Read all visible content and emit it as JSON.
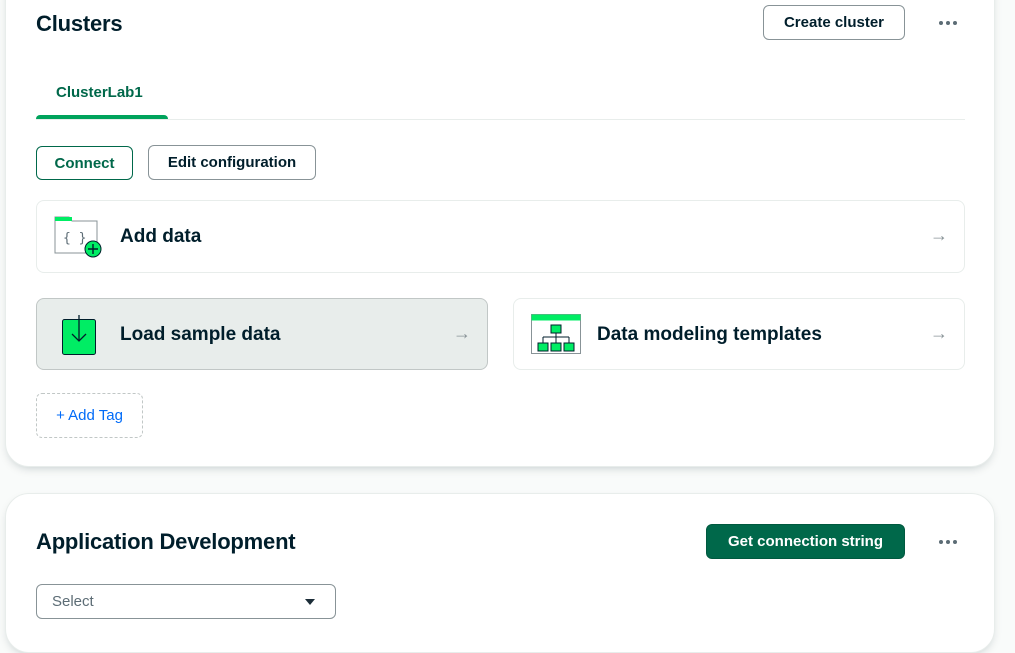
{
  "clusters": {
    "title": "Clusters",
    "create_button": "Create cluster",
    "more_menu": "more-options",
    "tabs": [
      {
        "label": "ClusterLab1",
        "selected": true
      }
    ],
    "connect_button": "Connect",
    "edit_button": "Edit configuration",
    "tiles": {
      "add_data": {
        "label": "Add data",
        "icon": "add-data-icon"
      },
      "load_sample": {
        "label": "Load sample data",
        "icon": "download-icon",
        "highlighted": true
      },
      "modeling": {
        "label": "Data modeling templates",
        "icon": "hierarchy-icon"
      }
    },
    "arrow": "→",
    "add_tag": "+ Add Tag"
  },
  "app_dev": {
    "title": "Application Development",
    "connection_button": "Get connection string",
    "select": {
      "value": "Select"
    }
  },
  "colors": {
    "brand_green": "#00684a",
    "accent_green": "#00ed64",
    "link_blue": "#016bf8",
    "text_dark": "#001e2b"
  }
}
